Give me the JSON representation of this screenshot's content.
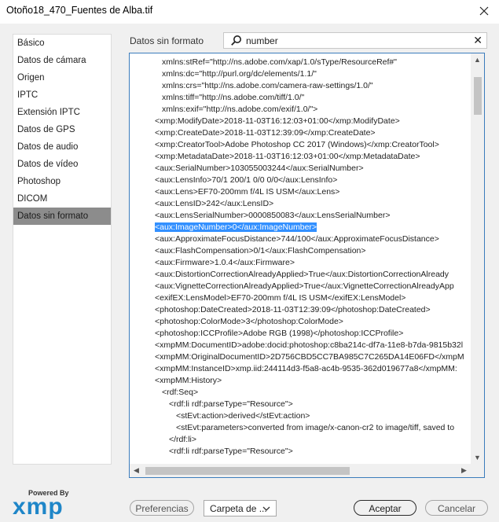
{
  "window": {
    "title": "Otoño18_470_Fuentes de Alba.tif"
  },
  "sidebar": {
    "items": [
      {
        "label": "Básico"
      },
      {
        "label": "Datos de cámara"
      },
      {
        "label": "Origen"
      },
      {
        "label": "IPTC"
      },
      {
        "label": "Extensión IPTC"
      },
      {
        "label": "Datos de GPS"
      },
      {
        "label": "Datos de audio"
      },
      {
        "label": "Datos de vídeo"
      },
      {
        "label": "Photoshop"
      },
      {
        "label": "DICOM"
      },
      {
        "label": "Datos sin formato"
      }
    ],
    "selected": "Datos sin formato"
  },
  "main": {
    "section_label": "Datos sin formato"
  },
  "search": {
    "value": "number",
    "icon": "search-icon",
    "clear_symbol": "✕"
  },
  "xml": {
    "highlight_text": "<aux:ImageNumber>0</aux:ImageNumber>",
    "lines": [
      {
        "indent": 41,
        "text": "xmlns:stRef=\"http://ns.adobe.com/xap/1.0/sType/ResourceRef#\""
      },
      {
        "indent": 41,
        "text": "xmlns:dc=\"http://purl.org/dc/elements/1.1/\""
      },
      {
        "indent": 41,
        "text": "xmlns:crs=\"http://ns.adobe.com/camera-raw-settings/1.0/\""
      },
      {
        "indent": 41,
        "text": "xmlns:tiff=\"http://ns.adobe.com/tiff/1.0/\""
      },
      {
        "indent": 41,
        "text": "xmlns:exif=\"http://ns.adobe.com/exif/1.0/\">"
      },
      {
        "indent": 32,
        "text": "<xmp:ModifyDate>2018-11-03T16:12:03+01:00</xmp:ModifyDate>"
      },
      {
        "indent": 32,
        "text": "<xmp:CreateDate>2018-11-03T12:39:09</xmp:CreateDate>"
      },
      {
        "indent": 32,
        "text": "<xmp:CreatorTool>Adobe Photoshop CC 2017 (Windows)</xmp:CreatorTool>"
      },
      {
        "indent": 32,
        "text": "<xmp:MetadataDate>2018-11-03T16:12:03+01:00</xmp:MetadataDate>"
      },
      {
        "indent": 32,
        "text": "<aux:SerialNumber>103055003244</aux:SerialNumber>"
      },
      {
        "indent": 32,
        "text": "<aux:LensInfo>70/1 200/1 0/0 0/0</aux:LensInfo>"
      },
      {
        "indent": 32,
        "text": "<aux:Lens>EF70-200mm f/4L IS USM</aux:Lens>"
      },
      {
        "indent": 32,
        "text": "<aux:LensID>242</aux:LensID>"
      },
      {
        "indent": 32,
        "text": "<aux:LensSerialNumber>0000850083</aux:LensSerialNumber>"
      },
      {
        "indent": 32,
        "text": "<aux:ImageNumber>0</aux:ImageNumber>",
        "highlight": true
      },
      {
        "indent": 32,
        "text": "<aux:ApproximateFocusDistance>744/100</aux:ApproximateFocusDistance>"
      },
      {
        "indent": 32,
        "text": "<aux:FlashCompensation>0/1</aux:FlashCompensation>"
      },
      {
        "indent": 32,
        "text": "<aux:Firmware>1.0.4</aux:Firmware>"
      },
      {
        "indent": 32,
        "text": "<aux:DistortionCorrectionAlreadyApplied>True</aux:DistortionCorrectionAlready"
      },
      {
        "indent": 32,
        "text": "<aux:VignetteCorrectionAlreadyApplied>True</aux:VignetteCorrectionAlreadyApp"
      },
      {
        "indent": 32,
        "text": "<exifEX:LensModel>EF70-200mm f/4L IS USM</exifEX:LensModel>"
      },
      {
        "indent": 32,
        "text": "<photoshop:DateCreated>2018-11-03T12:39:09</photoshop:DateCreated>"
      },
      {
        "indent": 32,
        "text": "<photoshop:ColorMode>3</photoshop:ColorMode>"
      },
      {
        "indent": 32,
        "text": "<photoshop:ICCProfile>Adobe RGB (1998)</photoshop:ICCProfile>"
      },
      {
        "indent": 32,
        "text": "<xmpMM:DocumentID>adobe:docid:photoshop:c8ba214c-df7a-11e8-b7da-9815b32l"
      },
      {
        "indent": 32,
        "text": "<xmpMM:OriginalDocumentID>2D756CBD5CC7BA985C7C265DA14E06FD</xmpM"
      },
      {
        "indent": 32,
        "text": "<xmpMM:InstanceID>xmp.iid:244114d3-f5a8-ac4b-9535-362d019677a8</xmpMM:"
      },
      {
        "indent": 32,
        "text": "<xmpMM:History>"
      },
      {
        "indent": 41,
        "text": "<rdf:Seq>"
      },
      {
        "indent": 50,
        "text": "<rdf:li rdf:parseType=\"Resource\">"
      },
      {
        "indent": 59,
        "text": "<stEvt:action>derived</stEvt:action>"
      },
      {
        "indent": 59,
        "text": "<stEvt:parameters>converted from image/x-canon-cr2 to image/tiff, saved to"
      },
      {
        "indent": 50,
        "text": "</rdf:li>"
      },
      {
        "indent": 50,
        "text": "<rdf:li rdf:parseType=\"Resource\">"
      }
    ]
  },
  "scroll": {
    "vertical_up": "▲",
    "vertical_down": "▼",
    "horizontal_left": "◀",
    "horizontal_right": "▶"
  },
  "logo": {
    "powered_by": "Powered By",
    "name": "xmp"
  },
  "buttons": {
    "preferences": "Preferencias",
    "folder_dropdown": "Carpeta de ...",
    "accept": "Aceptar",
    "cancel": "Cancelar"
  },
  "colors": {
    "selection_highlight": "#3390ff",
    "sidebar_selected": "#8c8c8c",
    "panel_border": "#3b7cbc",
    "logo_blue": "#1f86c8"
  }
}
